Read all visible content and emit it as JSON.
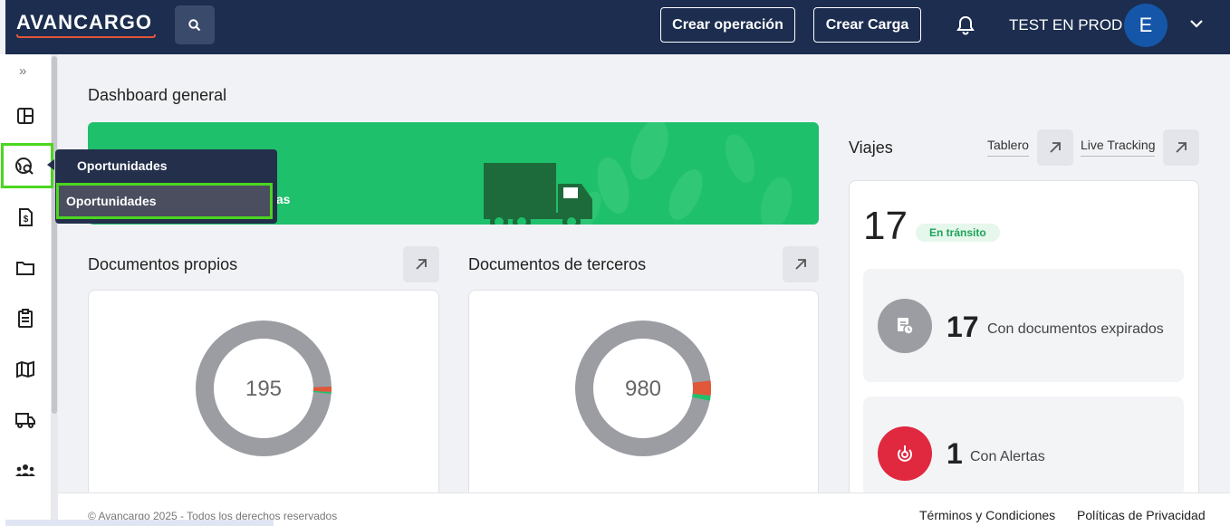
{
  "header": {
    "logo": "AVANCARGO",
    "create_operation": "Crear operación",
    "create_load": "Crear Carga",
    "user_name": "TEST EN PROD",
    "avatar_initial": "E"
  },
  "sidebar": {
    "expand_icon": "»",
    "items": [
      "dashboard-icon",
      "opportunities-icon",
      "invoice-icon",
      "folder-icon",
      "clipboard-icon",
      "map-icon",
      "truck-icon",
      "team-icon"
    ]
  },
  "popover": {
    "title": "Oportunidades",
    "item": "Oportunidades"
  },
  "main": {
    "page_title": "Dashboard general",
    "banner_text": "ías",
    "own_docs": {
      "title": "Documentos propios",
      "total": "195"
    },
    "third_docs": {
      "title": "Documentos de terceros",
      "total": "980"
    }
  },
  "trips": {
    "title": "Viajes",
    "link_board": "Tablero",
    "link_tracking": "Live Tracking",
    "total": "17",
    "status_chip": "En tránsito",
    "expired": {
      "value": "17",
      "label": "Con documentos expirados"
    },
    "alerts": {
      "value": "1",
      "label": "Con Alertas"
    }
  },
  "footer": {
    "copyright": "© Avancargo 2025 - Todos los derechos reservados",
    "terms": "Términos y Condiciones",
    "privacy": "Políticas de Privacidad"
  },
  "colors": {
    "navy": "#1c2d4f",
    "green": "#1fc06b",
    "highlight": "#4bd61f",
    "alert_red": "#e0283f",
    "avatar_blue": "#1556a8"
  }
}
